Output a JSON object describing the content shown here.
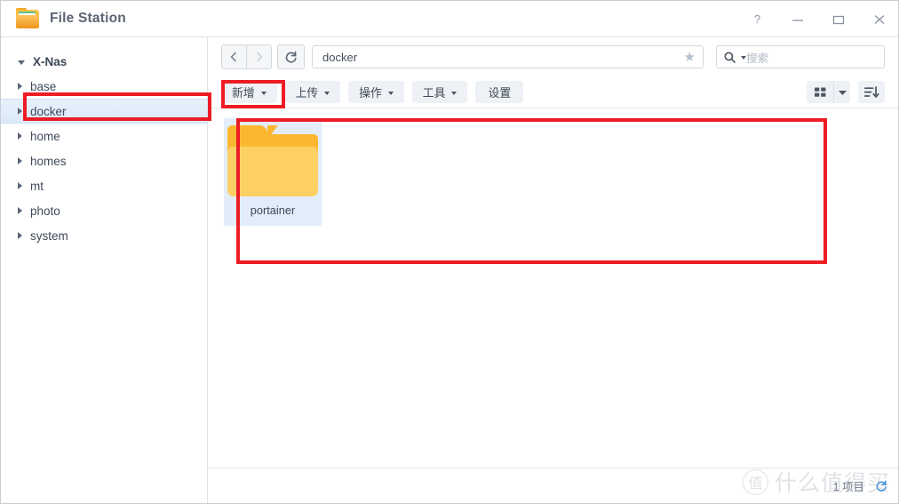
{
  "window": {
    "app_title": "File Station",
    "app_icon": "folder-app-icon",
    "controls": [
      {
        "name": "help-button",
        "glyph": "?",
        "label": "?"
      },
      {
        "name": "minimize-button",
        "glyph": "—",
        "label": "Minimize"
      },
      {
        "name": "maximize-button",
        "glyph": "▢",
        "label": "Maximize"
      },
      {
        "name": "close-button",
        "glyph": "✕",
        "label": "Close"
      }
    ]
  },
  "sidebar": {
    "root": {
      "label": "X-Nas",
      "expanded": true
    },
    "items": [
      {
        "label": "base",
        "selected": false
      },
      {
        "label": "docker",
        "selected": true
      },
      {
        "label": "home",
        "selected": false
      },
      {
        "label": "homes",
        "selected": false
      },
      {
        "label": "mt",
        "selected": false
      },
      {
        "label": "photo",
        "selected": false
      },
      {
        "label": "system",
        "selected": false
      }
    ]
  },
  "navbar": {
    "back_label": "‹",
    "forward_label": "›",
    "refresh_label": "⟳",
    "path_value": "docker",
    "favorite_icon": "star-icon",
    "search": {
      "icon": "search-icon",
      "placeholder": "搜索",
      "value": ""
    }
  },
  "toolbar": {
    "buttons": [
      {
        "label": "新增",
        "dropdown": true,
        "highlighted": true
      },
      {
        "label": "上传",
        "dropdown": true,
        "highlighted": false
      },
      {
        "label": "操作",
        "dropdown": true,
        "highlighted": false
      },
      {
        "label": "工具",
        "dropdown": true,
        "highlighted": false
      },
      {
        "label": "设置",
        "dropdown": false,
        "highlighted": false
      }
    ],
    "view_mode_icon": "grid-view-icon",
    "view_mode_caret_icon": "chevron-down-icon",
    "sort_icon": "sort-descending-icon"
  },
  "files": {
    "items": [
      {
        "name": "portainer",
        "type": "folder",
        "selected": true
      }
    ]
  },
  "statusbar": {
    "item_count_text": "1 项目",
    "refresh_icon": "refresh-icon"
  },
  "watermark": {
    "badge": "值",
    "text": "什么值得买"
  },
  "annotations": {
    "accent_color": "#ee1c24",
    "boxes": [
      {
        "target": "sidebar-item-docker"
      },
      {
        "target": "toolbar-button-new"
      },
      {
        "target": "file-list-area"
      }
    ]
  },
  "colors": {
    "selection_blue": "#e3edf9",
    "folder_gold": "#fbb730",
    "folder_light": "#fdd065",
    "text_primary": "#3e4856",
    "link_blue": "#3b8ede"
  }
}
